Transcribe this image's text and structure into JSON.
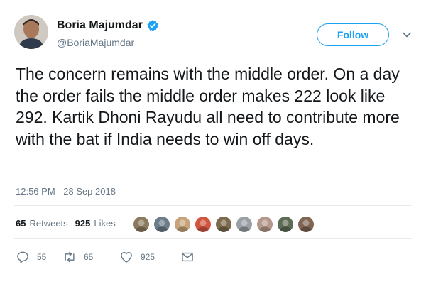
{
  "author": {
    "name": "Boria Majumdar",
    "handle": "@BoriaMajumdar"
  },
  "follow_label": "Follow",
  "tweet_text": "The concern remains with the middle order. On a day the order fails the middle order makes 222 look like 292. Kartik Dhoni Rayudu all need to contribute more with the bat if India needs to win off days.",
  "timestamp": "12:56 PM - 28 Sep 2018",
  "stats": {
    "retweets_count": "65",
    "retweets_label": "Retweets",
    "likes_count": "925",
    "likes_label": "Likes"
  },
  "likers": [
    {
      "color": "#8c7a5e"
    },
    {
      "color": "#6d7c8a"
    },
    {
      "color": "#c7a37a"
    },
    {
      "color": "#d2563f"
    },
    {
      "color": "#7b6a4c"
    },
    {
      "color": "#9aa0a6"
    },
    {
      "color": "#b5988a"
    },
    {
      "color": "#5e6b55"
    },
    {
      "color": "#7f6552"
    }
  ],
  "actions": {
    "replies": "55",
    "retweets": "65",
    "likes": "925"
  },
  "colors": {
    "accent": "#1da1f2",
    "verified": "#1da1f2",
    "muted": "#657786",
    "text": "#14171a"
  },
  "icons": [
    "verified-badge-icon",
    "chevron-down-icon",
    "reply-icon",
    "retweet-icon",
    "like-icon",
    "message-icon"
  ]
}
